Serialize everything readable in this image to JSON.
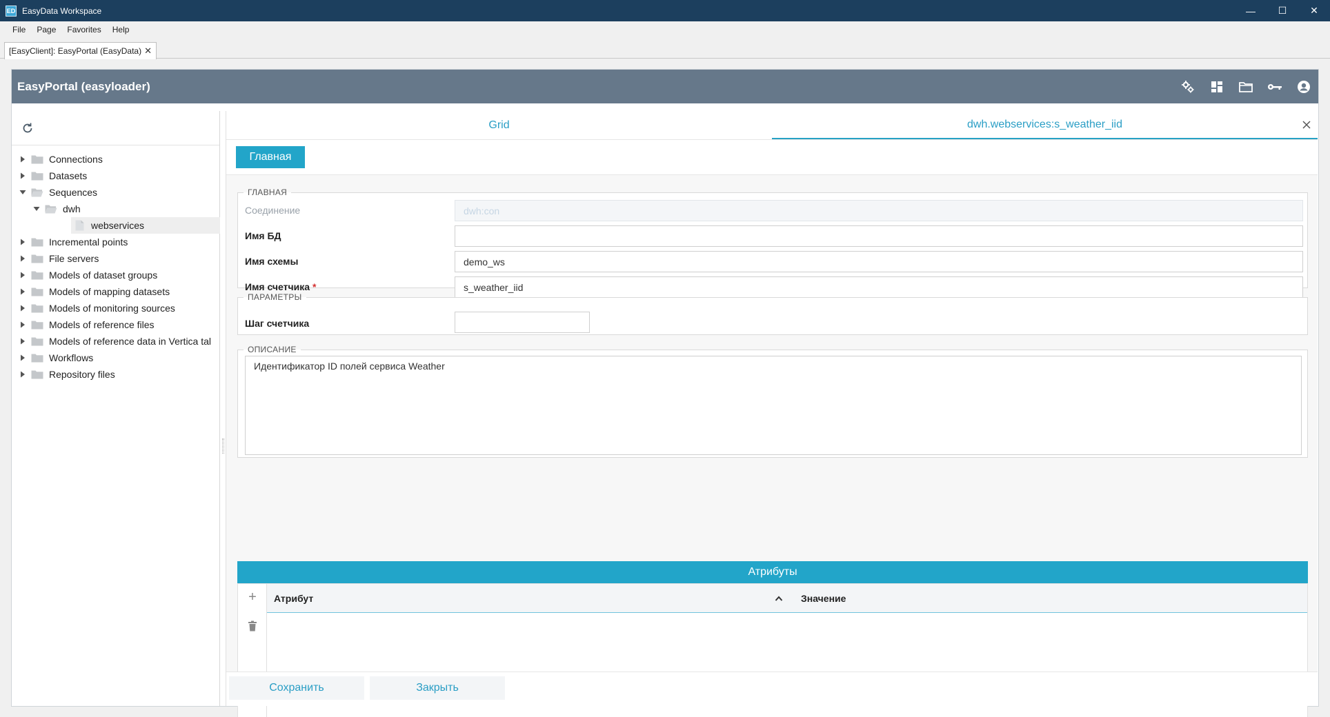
{
  "window": {
    "app_icon": "ED",
    "title": "EasyData Workspace",
    "minimize": "—",
    "maximize": "☐",
    "close": "✕"
  },
  "menu": [
    "File",
    "Page",
    "Favorites",
    "Help"
  ],
  "doc_tab": {
    "label": "[EasyClient]: EasyPortal (EasyData)",
    "close": "✕"
  },
  "portal": {
    "title": "EasyPortal (easyloader)",
    "icons": [
      "settings-icon",
      "dashboard-icon",
      "folder-icon",
      "key-icon",
      "account-icon"
    ]
  },
  "tree": {
    "nodes": [
      {
        "label": "Connections",
        "level": 0,
        "expanded": false,
        "selected": false
      },
      {
        "label": "Datasets",
        "level": 0,
        "expanded": false,
        "selected": false
      },
      {
        "label": "Sequences",
        "level": 0,
        "expanded": true,
        "selected": false
      },
      {
        "label": "dwh",
        "level": 1,
        "expanded": true,
        "selected": false
      },
      {
        "label": "webservices",
        "level": 2,
        "leaf": true,
        "selected": true
      },
      {
        "label": "Incremental points",
        "level": 0,
        "expanded": false,
        "selected": false
      },
      {
        "label": "File servers",
        "level": 0,
        "expanded": false,
        "selected": false
      },
      {
        "label": "Models of dataset groups",
        "level": 0,
        "expanded": false,
        "selected": false
      },
      {
        "label": "Models of mapping datasets",
        "level": 0,
        "expanded": false,
        "selected": false
      },
      {
        "label": "Models of monitoring sources",
        "level": 0,
        "expanded": false,
        "selected": false
      },
      {
        "label": "Models of reference files",
        "level": 0,
        "expanded": false,
        "selected": false
      },
      {
        "label": "Models of reference data in Vertica tal",
        "level": 0,
        "expanded": false,
        "selected": false
      },
      {
        "label": "Workflows",
        "level": 0,
        "expanded": false,
        "selected": false
      },
      {
        "label": "Repository files",
        "level": 0,
        "expanded": false,
        "selected": false
      }
    ]
  },
  "tabs": [
    {
      "label": "Grid",
      "active": false
    },
    {
      "label": "dwh.webservices:s_weather_iid",
      "active": true
    }
  ],
  "main_button": "Главная",
  "groups": {
    "main": {
      "legend": "ГЛАВНАЯ",
      "connection_label": "Соединение",
      "connection_value": "dwh:con",
      "db_label": "Имя БД",
      "db_value": "",
      "schema_label": "Имя схемы",
      "schema_value": "demo_ws",
      "counter_label": "Имя счетчика",
      "counter_required": "*",
      "counter_value": "s_weather_iid"
    },
    "params": {
      "legend": "ПАРАМЕТРЫ",
      "step_label": "Шаг счетчика",
      "step_value": ""
    },
    "description": {
      "legend": "ОПИСАНИЕ",
      "text": "Идентификатор ID полей сервиса Weather"
    }
  },
  "attributes": {
    "title": "Атрибуты",
    "col_attr": "Атрибут",
    "col_value": "Значение",
    "add_icon": "+",
    "rows": []
  },
  "buttons": {
    "save": "Сохранить",
    "close": "Закрыть"
  }
}
